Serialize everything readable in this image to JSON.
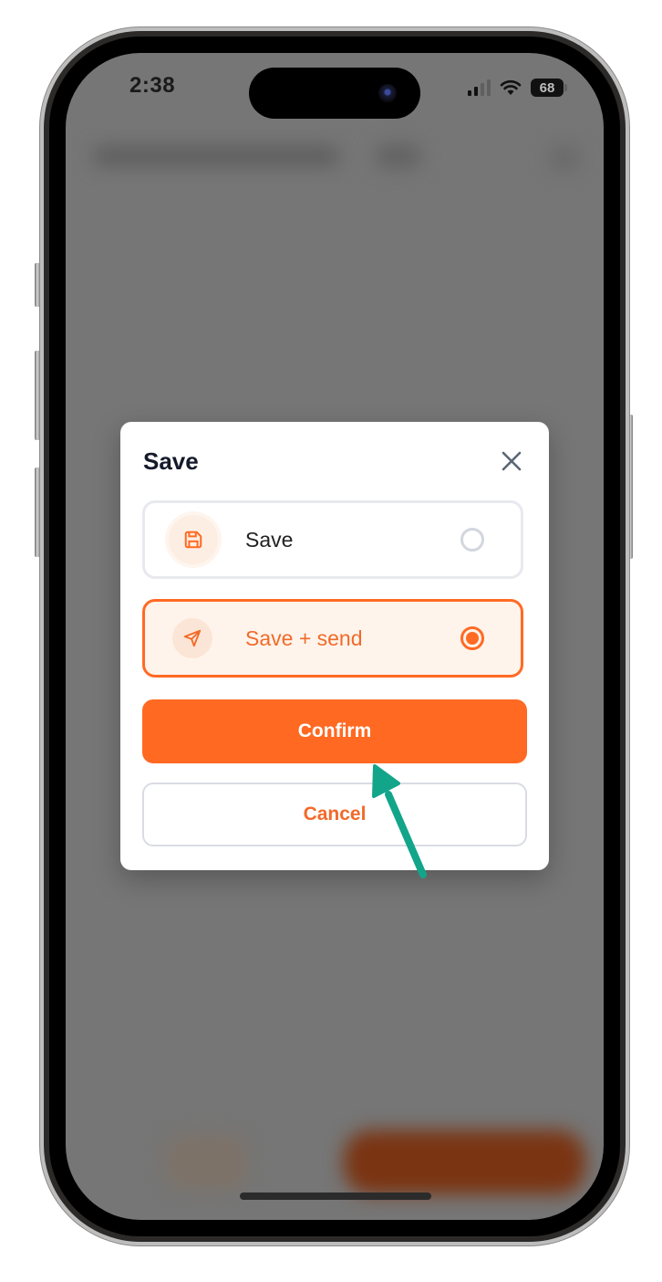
{
  "status_bar": {
    "time": "2:38",
    "battery": "68",
    "signal_icon": "cellular-signal-icon",
    "wifi_icon": "wifi-icon"
  },
  "dialog": {
    "title": "Save",
    "close_icon": "close-icon",
    "options": [
      {
        "label": "Save",
        "icon": "floppy-disk-icon",
        "selected": false
      },
      {
        "label": "Save + send",
        "icon": "paper-plane-icon",
        "selected": true
      }
    ],
    "confirm_label": "Confirm",
    "cancel_label": "Cancel"
  },
  "annotation": {
    "type": "arrow",
    "points_to": "confirm-button",
    "color": "#12a58a"
  },
  "colors": {
    "accent": "#ff6922",
    "selected_bg": "#fff4eb",
    "title_text": "#141a2a",
    "overlay": "#767676"
  }
}
